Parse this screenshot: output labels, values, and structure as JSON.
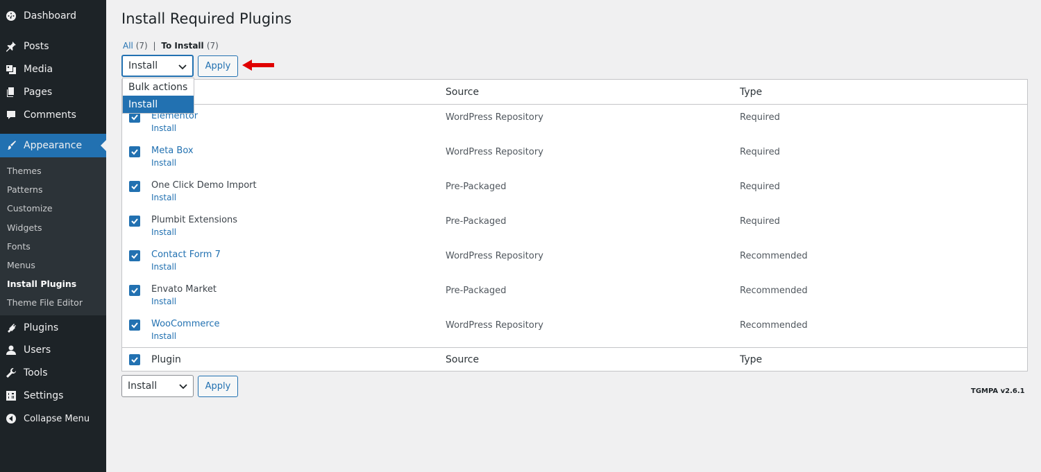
{
  "sidebar": {
    "items": [
      {
        "label": "Dashboard",
        "icon": "dashboard-icon"
      },
      {
        "label": "Posts",
        "icon": "pin-icon"
      },
      {
        "label": "Media",
        "icon": "media-icon"
      },
      {
        "label": "Pages",
        "icon": "pages-icon"
      },
      {
        "label": "Comments",
        "icon": "comment-icon"
      },
      {
        "label": "Appearance",
        "icon": "paintbrush-icon"
      },
      {
        "label": "Plugins",
        "icon": "plugin-icon"
      },
      {
        "label": "Users",
        "icon": "users-icon"
      },
      {
        "label": "Tools",
        "icon": "wrench-icon"
      },
      {
        "label": "Settings",
        "icon": "settings-icon"
      },
      {
        "label": "Collapse Menu",
        "icon": "collapse-icon"
      }
    ],
    "submenu": [
      "Themes",
      "Patterns",
      "Customize",
      "Widgets",
      "Fonts",
      "Menus",
      "Install Plugins",
      "Theme File Editor"
    ],
    "active": "Appearance",
    "current_sub": "Install Plugins"
  },
  "page": {
    "title": "Install Required Plugins",
    "filters": {
      "all_label": "All",
      "all_count": "(7)",
      "separator": "|",
      "install_label": "To Install",
      "install_count": "(7)"
    }
  },
  "bulk_top": {
    "selected": "Install",
    "apply": "Apply",
    "options": [
      "Bulk actions",
      "Install"
    ]
  },
  "bulk_bottom": {
    "selected": "Install",
    "apply": "Apply"
  },
  "table": {
    "headers": {
      "plugin": "Plugin",
      "source": "Source",
      "type": "Type"
    },
    "rows": [
      {
        "name": "Elementor",
        "action": "Install",
        "source": "WordPress Repository",
        "type": "Required",
        "linked": true
      },
      {
        "name": "Meta Box",
        "action": "Install",
        "source": "WordPress Repository",
        "type": "Required",
        "linked": true
      },
      {
        "name": "One Click Demo Import",
        "action": "Install",
        "source": "Pre-Packaged",
        "type": "Required",
        "linked": false
      },
      {
        "name": "Plumbit Extensions",
        "action": "Install",
        "source": "Pre-Packaged",
        "type": "Required",
        "linked": false
      },
      {
        "name": "Contact Form 7",
        "action": "Install",
        "source": "WordPress Repository",
        "type": "Recommended",
        "linked": true
      },
      {
        "name": "Envato Market",
        "action": "Install",
        "source": "Pre-Packaged",
        "type": "Recommended",
        "linked": false
      },
      {
        "name": "WooCommerce",
        "action": "Install",
        "source": "WordPress Repository",
        "type": "Recommended",
        "linked": true
      }
    ]
  },
  "footer": {
    "version": "TGMPA v2.6.1"
  },
  "colors": {
    "accent": "#2271b1",
    "sidebar_bg": "#1d2327",
    "arrow": "#e00000"
  }
}
